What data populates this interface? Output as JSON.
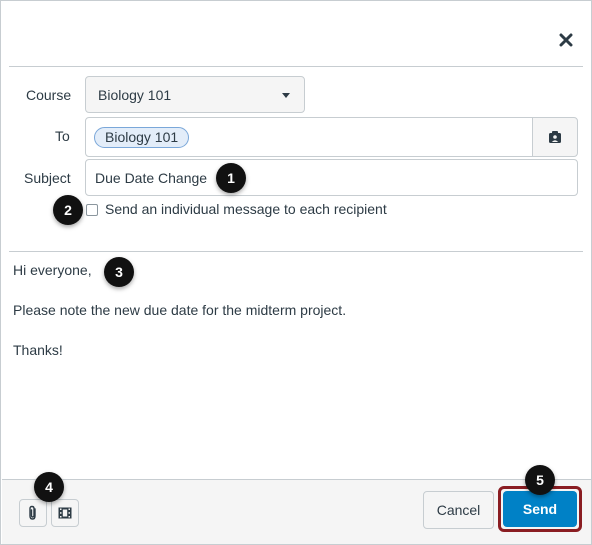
{
  "dialog": {
    "close_icon": "close-icon"
  },
  "form": {
    "course_label": "Course",
    "course_value": "Biology 101",
    "to_label": "To",
    "to_recipient": "Biology 101",
    "subject_label": "Subject",
    "subject_value": "Due Date Change",
    "individual_message_label": "Send an individual message to each recipient",
    "individual_message_checked": false
  },
  "message": {
    "line1": "Hi everyone,",
    "line2": "Please note the new due date for the midterm project.",
    "line3": "Thanks!"
  },
  "footer": {
    "attach_icon": "paperclip-icon",
    "media_icon": "media-icon",
    "cancel_label": "Cancel",
    "send_label": "Send"
  },
  "callouts": {
    "c1": "1",
    "c2": "2",
    "c3": "3",
    "c4": "4",
    "c5": "5"
  },
  "colors": {
    "accent": "#0081c6",
    "highlight": "#8a1d22",
    "token_bg": "#e3edf9"
  }
}
